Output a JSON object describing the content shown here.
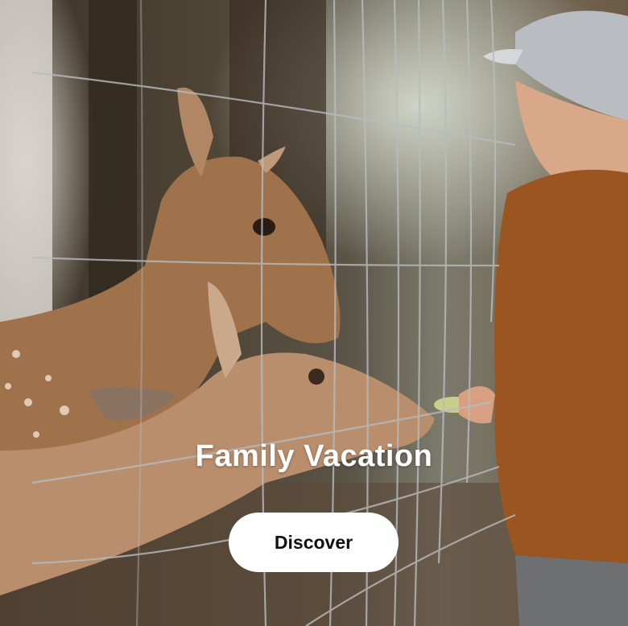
{
  "hero": {
    "title": "Family Vacation",
    "button_label": "Discover"
  },
  "colors": {
    "button_bg": "#ffffff",
    "title_color": "#ffffff"
  }
}
